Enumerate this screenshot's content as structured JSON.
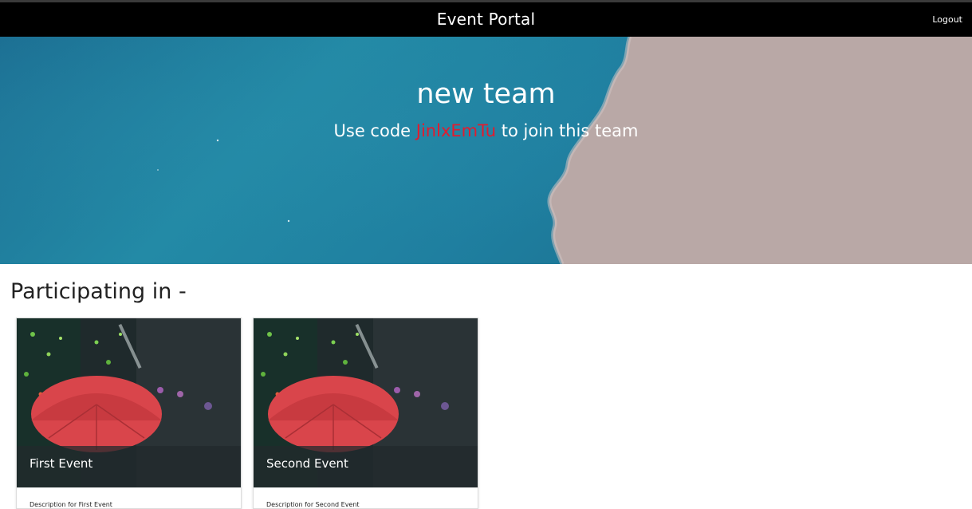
{
  "navbar": {
    "title": "Event Portal",
    "logout_label": "Logout"
  },
  "hero": {
    "team_name": "new team",
    "code_prefix": "Use code",
    "code": "JinlxEmTu",
    "code_suffix": "to join this team",
    "code_color": "#e31b2e"
  },
  "section": {
    "title": "Participating in -"
  },
  "events": [
    {
      "title": "First Event",
      "description": "Description for First Event",
      "image": "red-umbrella-night-street-image"
    },
    {
      "title": "Second Event",
      "description": "Description for Second Event",
      "image": "red-umbrella-night-street-image"
    }
  ],
  "colors": {
    "navbar_bg": "#000000",
    "water": "#1f7fa0",
    "sand": "#b9a8a6",
    "umbrella": "#d9454b"
  }
}
